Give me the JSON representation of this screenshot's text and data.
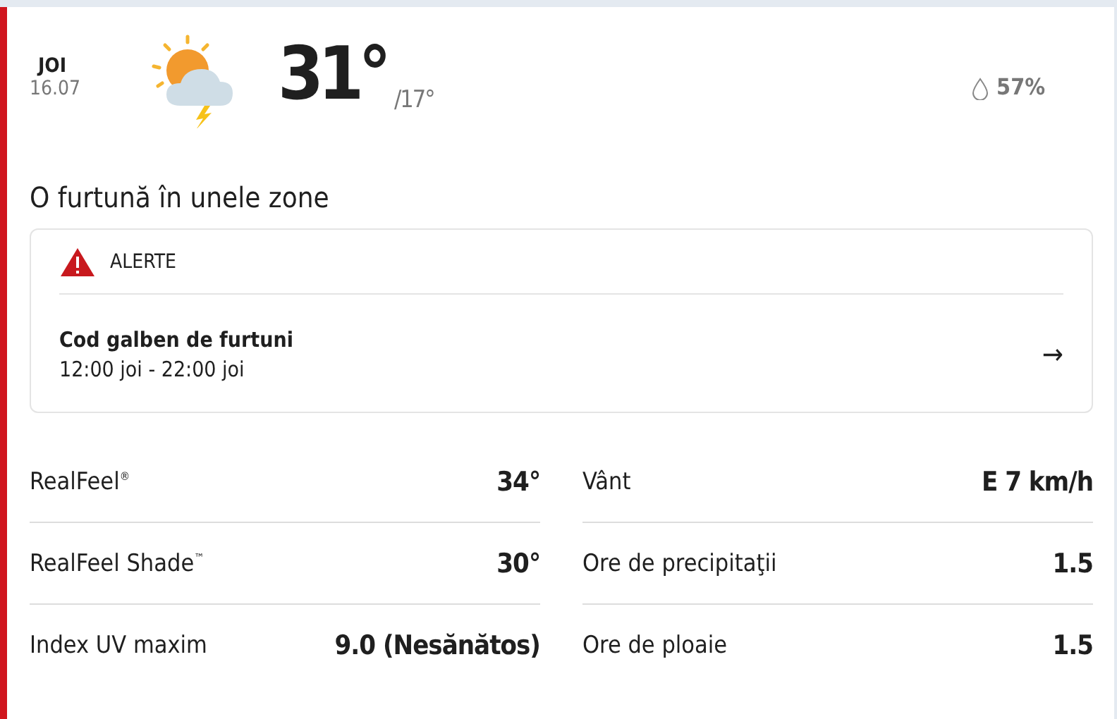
{
  "day": {
    "name": "JOI",
    "date": "16.07"
  },
  "temperature": {
    "high": "31°",
    "low": "/17°"
  },
  "humidity": "57%",
  "phrase": "O furtună în unele zone",
  "alerts": {
    "heading": "ALERTE",
    "title": "Cod galben de furtuni",
    "time": "12:00 joi - 22:00 joi",
    "arrow": "→"
  },
  "details_left": [
    {
      "label": "RealFeel$^{®}$",
      "value": "34°"
    },
    {
      "label": "RealFeel Shade$^{™}$",
      "value": "30°"
    },
    {
      "label": "Index UV maxim",
      "value": "9.0 (Nesănătos)"
    }
  ],
  "details_right": [
    {
      "label": "Vânt",
      "value": "E 7 km/h"
    },
    {
      "label": "Ore de precipitaţii",
      "value": "1.5"
    },
    {
      "label": "Ore de ploaie",
      "value": "1.5"
    }
  ]
}
